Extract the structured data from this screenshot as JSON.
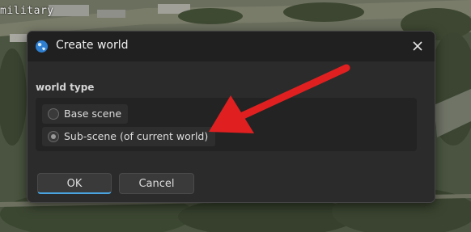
{
  "background": {
    "map_label": "military"
  },
  "dialog": {
    "title": "Create world",
    "title_icon": "globe-icon",
    "close_icon": "close-icon",
    "group_label": "world type",
    "options": [
      {
        "label": "Base scene",
        "selected": false
      },
      {
        "label": "Sub-scene (of current world)",
        "selected": true
      }
    ],
    "ok_label": "OK",
    "cancel_label": "Cancel"
  },
  "annotation": {
    "arrow_color": "#e02020"
  },
  "colors": {
    "dialog_bg": "#2b2b2b",
    "titlebar_bg": "#202020",
    "accent": "#4aa3df"
  }
}
